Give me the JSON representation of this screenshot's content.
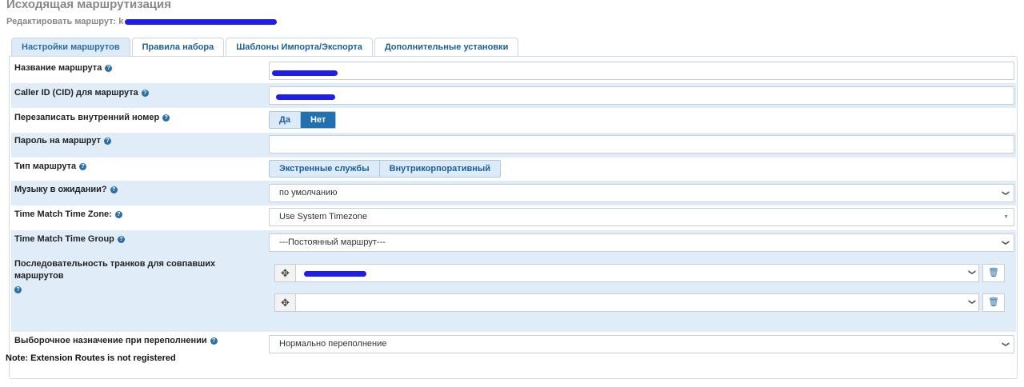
{
  "header": {
    "title": "Исходящая маршрутизация",
    "subtitle": "Редактировать маршрут: k"
  },
  "tabs": [
    {
      "label": "Настройки маршрутов",
      "active": true
    },
    {
      "label": "Правила набора",
      "active": false
    },
    {
      "label": "Шаблоны Импорта/Экспорта",
      "active": false
    },
    {
      "label": "Дополнительные установки",
      "active": false
    }
  ],
  "form": {
    "route_name": {
      "label": "Название маршрута",
      "value": ""
    },
    "caller_id": {
      "label": "Caller ID (CID) для маршрута",
      "value": ""
    },
    "override_extension": {
      "label": "Перезаписать внутренний номер",
      "options": [
        "Да",
        "Нет"
      ],
      "selected": "Нет"
    },
    "route_password": {
      "label": "Пароль на маршрут",
      "value": ""
    },
    "route_type": {
      "label": "Тип маршрута",
      "options": [
        "Экстренные службы",
        "Внутрикорпоративный"
      ]
    },
    "music_on_hold": {
      "label": "Музыку в ожидании?",
      "value": "по умолчанию"
    },
    "time_zone": {
      "label": "Time Match Time Zone:",
      "value": "Use System Timezone"
    },
    "time_group": {
      "label": "Time Match Time Group",
      "value": "---Постоянный маршрут---"
    },
    "trunk_sequence": {
      "label": "Последовательность транков для совпавших маршрутов",
      "trunks": [
        "",
        ""
      ]
    },
    "overflow_destination": {
      "label": "Выборочное назначение при переполнении",
      "value": "Нормально переполнение"
    }
  },
  "note": "Note: Extension Routes is not registered",
  "icons": {
    "help": "help-icon",
    "drag": "drag-handle-icon",
    "delete": "trash-icon",
    "caret": "chevron-down-icon"
  },
  "colors": {
    "accent": "#2270b0",
    "row_alt": "#e0edf8",
    "redaction": "#1e1ee6"
  }
}
